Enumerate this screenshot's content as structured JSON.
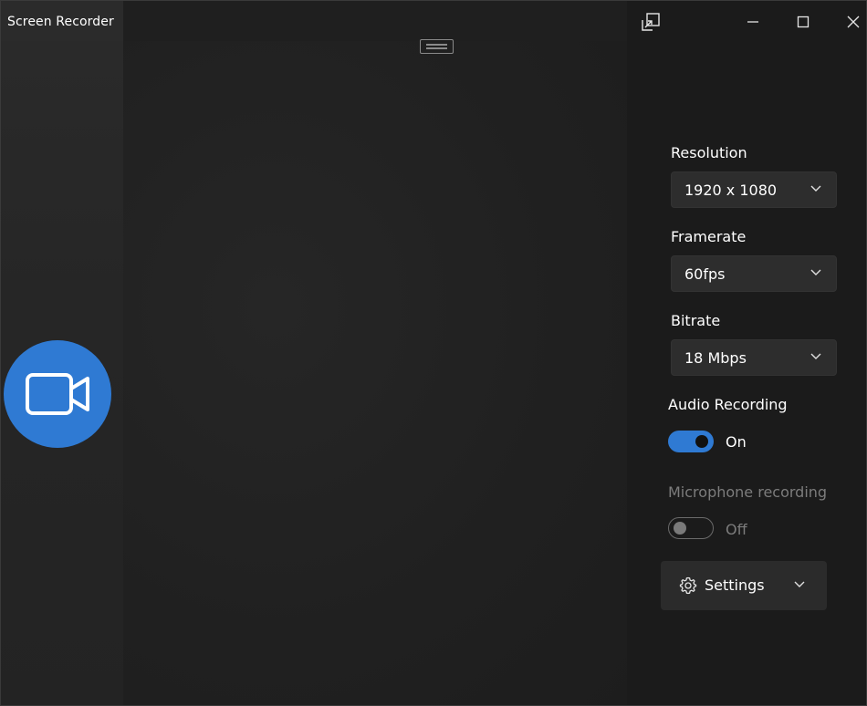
{
  "window": {
    "title": "Screen Recorder"
  },
  "titlebar": {
    "icons": [
      "restore-overlay-icon",
      "minimize-icon",
      "maximize-icon",
      "close-icon"
    ]
  },
  "record": {
    "icon": "video-camera-icon",
    "color": "#2f7ad3"
  },
  "settings": {
    "resolution": {
      "label": "Resolution",
      "value": "1920 x 1080"
    },
    "framerate": {
      "label": "Framerate",
      "value": "60fps"
    },
    "bitrate": {
      "label": "Bitrate",
      "value": "18 Mbps"
    },
    "audio": {
      "label": "Audio Recording",
      "state": "On",
      "enabled": true
    },
    "microphone": {
      "label": "Microphone recording",
      "state": "Off",
      "enabled": false
    },
    "settings_button": {
      "label": "Settings",
      "icon": "gear-icon"
    }
  },
  "colors": {
    "accent": "#2f7ad3",
    "background": "#1f1f1f",
    "panel": "#1b1b1b",
    "control": "#2d2d2d"
  }
}
